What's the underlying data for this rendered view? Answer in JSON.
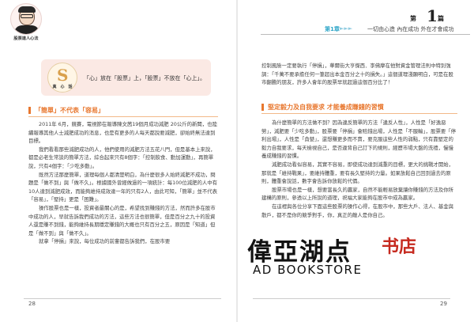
{
  "header": {
    "author_caption": "股票達人心法",
    "chapter_prefix": "第",
    "chapter_number": "1",
    "chapter_suffix": "篇",
    "chapter_label": "第1章",
    "chapter_arrows": "►►►",
    "chapter_title": "一切由心造 內在成功 外在才會成功"
  },
  "quote": {
    "icon_letter": "S",
    "icon_caption": "真　心　話",
    "text": "「心」放在「股票」上，「股票」不放在「心上」。"
  },
  "sections": {
    "left_heading": "「簡單」不代表「容易」",
    "right_heading": "堅定毅力及自我要求 才能養成賺錢的習慣"
  },
  "left_paragraphs": [
    "2011年 6月，競賽，電視節在報導陳文茜19個月成功減肥 20公斤的新聞，也陸續報導其他人士減肥成功的消息，也是有更多的人每天都說要減肥，卻始終無法達到目標。",
    "我們看看那些減肥成功的人，他們使用的減肥方法五花八門，但是基本上來說，都是必老生常談的簡單方法，綜合起來只有8個字：「控制飲食、動加運動」，再簡單說，只有4個字：「少吃多動」。",
    "既然方法那麼簡單，道理每個人都清楚明白，為什麼很多人始終減肥不成功，問題是「做不到」與「做不久」。根據國外曾經做過的一項統計：每100位減肥的人中有10人達到減肥成效，而能夠維持成效達一年的只有2人，由此可知，「簡單」並不代表「容易」，「堅持」更是「困難」。",
    "操作股票也是一樣，投資者最關心的是，希望找到賺錢的方法，然而許多在股市中成功的人，早就告訴我們成功的方法，這些方法也很簡單，但是百分之九十的投資人還是賺不到錢，能夠維持長期穩定賺錢的大概也只有百分之五，原因是「知道」但是「做不到」與「做不久」。",
    "就拿「停損」來說，每位成功的前輩都告訴我們，在股市要"
  ],
  "right_paragraphs_top": [
    "控制風險一定要執行「停損」，華爾街大亨傑西．李佛摩在他對資金管理法則中特別強調：「千萬不要承擔任何一筆超出本金百分之十的損失。」這個道理淺顯明白，可是在股市翻騰的朋友，許多人會年的股票早就超過這個百分比了！"
  ],
  "right_paragraphs": [
    "為什麼簡單的方法做不到？因為違反簡單的方法「違反人性」，人性是「好逸惡勞」，減肥要「少吃多動」，股票要「停損」會賠錢出場，人性是「不服輸」，股票要「停利出場」，人性是「貪婪」，還想賺更多而不賣，要克服這些人性的弱點，只有靠堅定的毅力自我要求，每天檢視自己，是否違背自己訂下的規則，經歷市場大盤的洗禮，慢慢養成賺錢的習慣。",
    "減肥成功看似容易，其實不容易，即使成功達到減重的目標，更大的挑戰才開始，那就是「維持戰果」，要維持體重，要有長久堅持的力量。如果放鬆自己回到過去的原則，體重會說話，數字會告訴你放鬆的代價。",
    "股票市場也是一樣，想要當長久的贏家，自然不能輕易放棄讓你賺錢的方法及你所建構的原則，參透以上所說的道理，祝福大家能夠在股市中成為贏家。",
    "在這裡與各位分享下面這些股票的操作心得，在股市中，那些大戶、法人、基金與散戶，都不是你的競爭對手，你，真正的敵人是你自己。"
  ],
  "footer": {
    "left_page": "28",
    "right_page": "29"
  },
  "watermark": {
    "cn_main": "偉亞湖点",
    "cn_accent": "书店",
    "en": "AD BOOKSTORE"
  },
  "colors": {
    "accent_orange": "#e8772e",
    "accent_blue": "#2fa6c8",
    "quote_bg": "#fbe9e4"
  }
}
